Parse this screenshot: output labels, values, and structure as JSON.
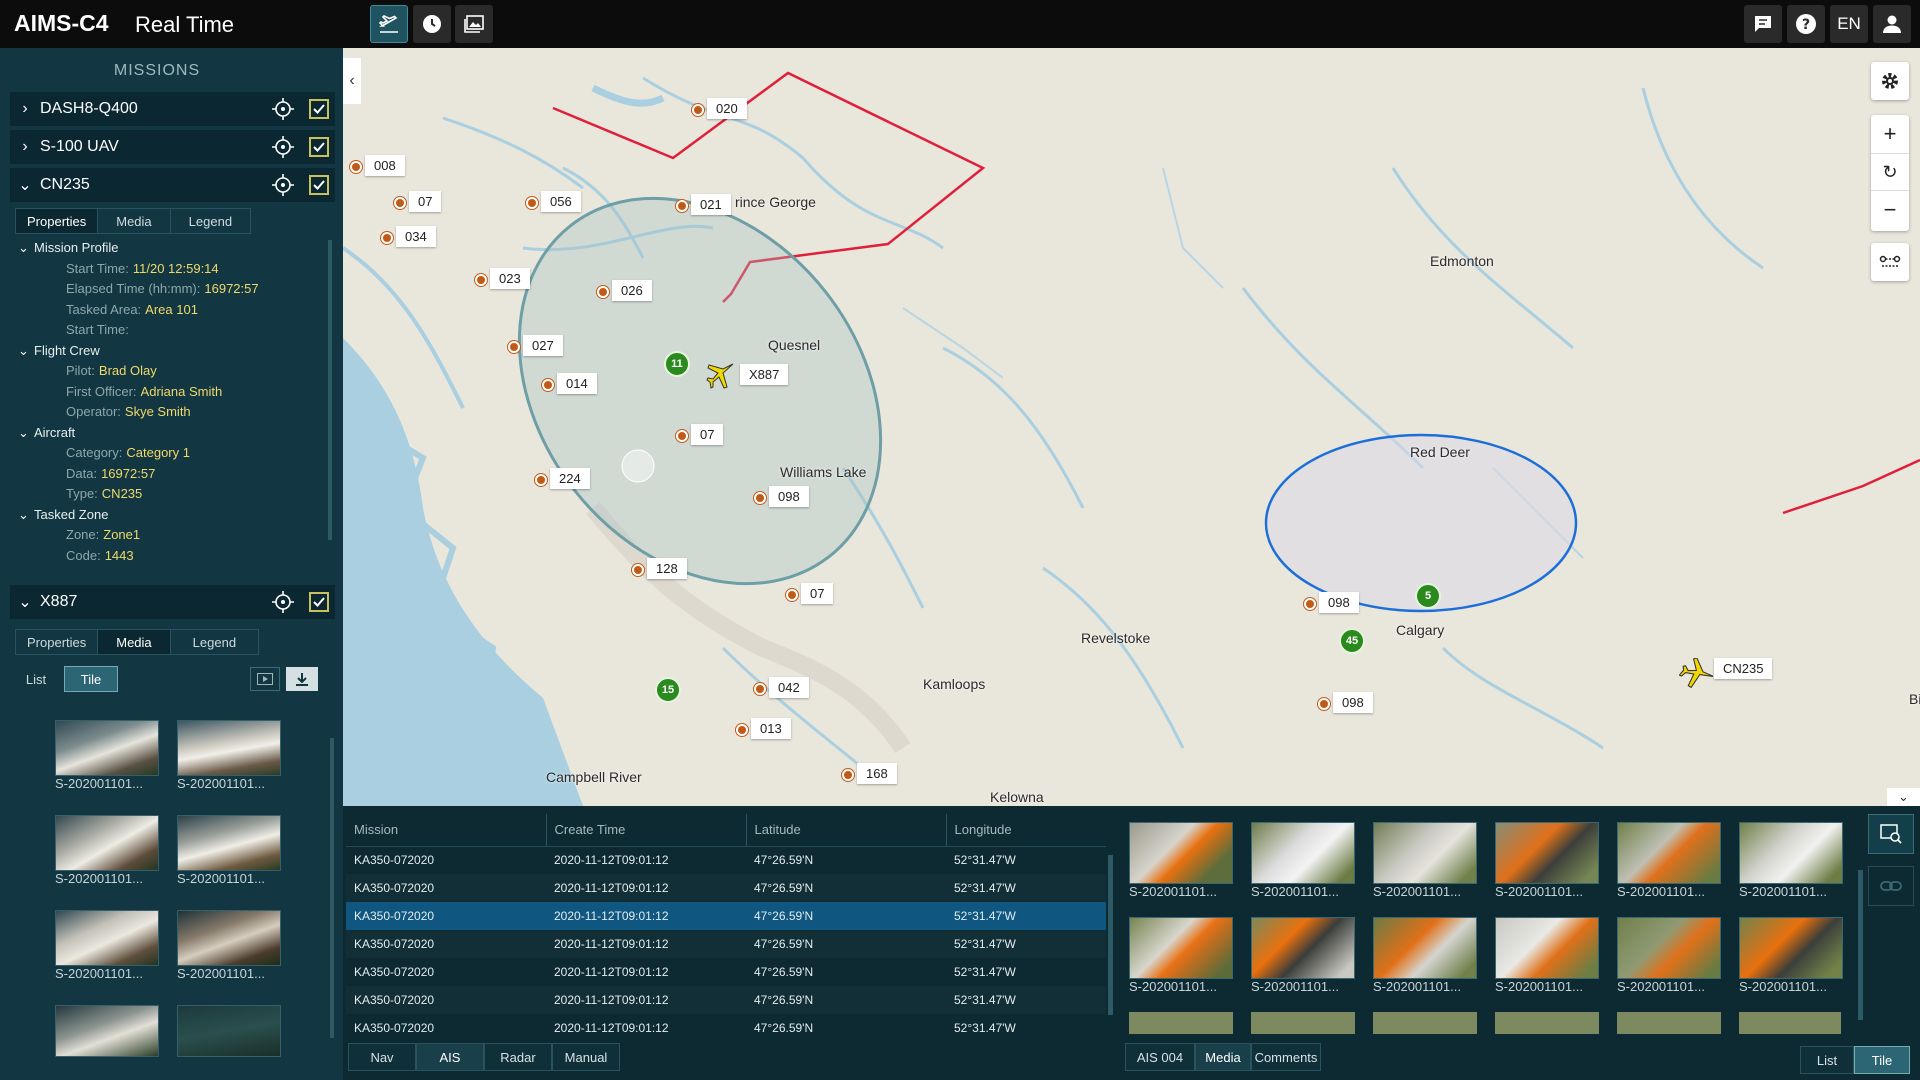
{
  "app": {
    "logo": "AIMS-C4",
    "title": "Real Time",
    "language": "EN"
  },
  "topbar": {
    "icons": [
      "flight-icon",
      "clock-icon",
      "gallery-icon"
    ],
    "right_icons": [
      "chat-icon",
      "help-icon",
      "user-icon"
    ]
  },
  "sidebar": {
    "heading": "MISSIONS",
    "missions": [
      {
        "name": "DASH8-Q400",
        "expanded": false,
        "checked": true
      },
      {
        "name": "S-100 UAV",
        "expanded": false,
        "checked": true
      },
      {
        "name": "CN235",
        "expanded": true,
        "checked": true
      },
      {
        "name": "X887",
        "expanded": true,
        "checked": true
      }
    ],
    "tabs": [
      "Properties",
      "Media",
      "Legend"
    ],
    "properties": {
      "mission_profile": {
        "title": "Mission Profile",
        "start_time_label": "Start Time:",
        "start_time": "11/20 12:59:14",
        "elapsed_label": "Elapsed Time (hh:mm):",
        "elapsed": "16972:57",
        "tasked_area_label": "Tasked Area:",
        "tasked_area": "Area 101",
        "start_time2_label": "Start Time:"
      },
      "flight_crew": {
        "title": "Flight Crew",
        "pilot_label": "Pilot:",
        "pilot": "Brad Olay",
        "first_officer_label": "First Officer:",
        "first_officer": "Adriana Smith",
        "operator_label": "Operator:",
        "operator": "Skye Smith"
      },
      "aircraft": {
        "title": "Aircraft",
        "category_label": "Category:",
        "category": "Category 1",
        "data_label": "Data:",
        "data": "16972:57",
        "type_label": "Type:",
        "type": "CN235"
      },
      "tasked_zone": {
        "title": "Tasked Zone",
        "zone_label": "Zone:",
        "zone": "Zone1",
        "code_label": "Code:",
        "code": "1443"
      }
    },
    "x887_view": {
      "list": "List",
      "tile": "Tile"
    },
    "media_captions": [
      "S-202001101...",
      "S-202001101...",
      "S-202001101...",
      "S-202001101...",
      "S-202001101...",
      "S-202001101..."
    ]
  },
  "map": {
    "labels": [
      "rince George",
      "Quesnel",
      "Williams Lake",
      "Edmonton",
      "Red Deer",
      "Revelstoke",
      "Kamloops",
      "Calgary",
      "Campbell River",
      "Kelowna",
      "Bi"
    ],
    "markers": [
      "020",
      "008",
      "07",
      "034",
      "056",
      "021",
      "023",
      "026",
      "027",
      "014",
      "07",
      "224",
      "098",
      "128",
      "07",
      "042",
      "013",
      "168",
      "098",
      "098"
    ],
    "badges": [
      "11",
      "15",
      "5",
      "45"
    ],
    "aircraft": [
      "X887",
      "CN235"
    ]
  },
  "table": {
    "headers": [
      "Mission",
      "Create Time",
      "Latitude",
      "Longitude"
    ],
    "rows": [
      [
        "KA350-072020",
        "2020-11-12T09:01:12",
        "47°26.59'N",
        "52°31.47'W"
      ],
      [
        "KA350-072020",
        "2020-11-12T09:01:12",
        "47°26.59'N",
        "52°31.47'W"
      ],
      [
        "KA350-072020",
        "2020-11-12T09:01:12",
        "47°26.59'N",
        "52°31.47'W"
      ],
      [
        "KA350-072020",
        "2020-11-12T09:01:12",
        "47°26.59'N",
        "52°31.47'W"
      ],
      [
        "KA350-072020",
        "2020-11-12T09:01:12",
        "47°26.59'N",
        "52°31.47'W"
      ],
      [
        "KA350-072020",
        "2020-11-12T09:01:12",
        "47°26.59'N",
        "52°31.47'W"
      ],
      [
        "KA350-072020",
        "2020-11-12T09:01:12",
        "47°26.59'N",
        "52°31.47'W"
      ]
    ],
    "selected_index": 2,
    "tabs": [
      "Nav",
      "AIS",
      "Radar",
      "Manual"
    ]
  },
  "media_panel": {
    "captions": [
      "S-202001101...",
      "S-202001101...",
      "S-202001101...",
      "S-202001101...",
      "S-202001101...",
      "S-202001101...",
      "S-202001101...",
      "S-202001101...",
      "S-202001101...",
      "S-202001101...",
      "S-202001101...",
      "S-202001101..."
    ],
    "tabs": [
      "AIS 004",
      "Media",
      "Comments"
    ],
    "view": {
      "list": "List",
      "tile": "Tile"
    }
  },
  "colors": {
    "accent": "#c9c060",
    "route": "#e0203a",
    "ellipse": "#1c6fd8",
    "selected_row": "#0f5781"
  }
}
